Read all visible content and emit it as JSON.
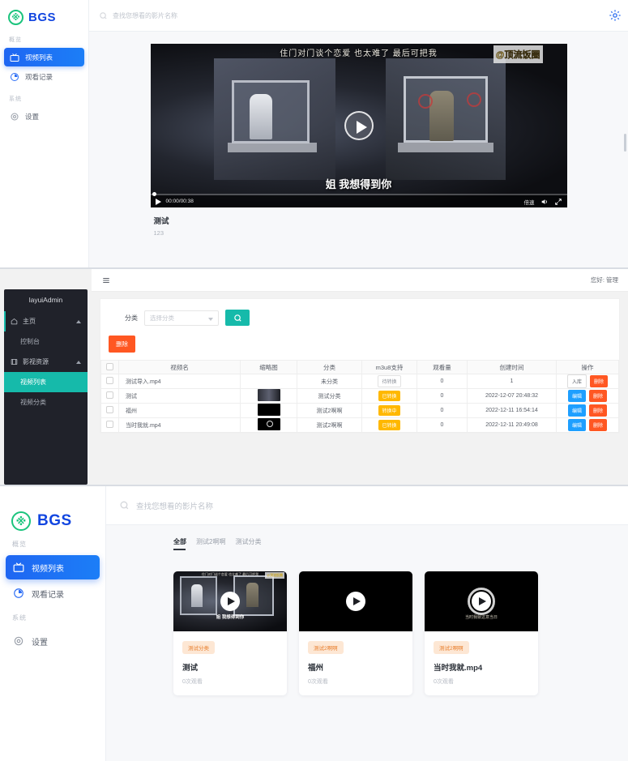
{
  "panel_player": {
    "brand": {
      "logo_char": "※",
      "name": "BGS"
    },
    "nav": {
      "group1_label": "概览",
      "group2_label": "系统",
      "items": [
        {
          "label": "视频列表",
          "icon": "tv-icon",
          "active": true
        },
        {
          "label": "观看记录",
          "icon": "clock-pie-icon",
          "active": false
        },
        {
          "label": "设置",
          "icon": "gear-icon",
          "active": false
        }
      ]
    },
    "search": {
      "placeholder": "查找您想看的影片名称",
      "value": ""
    },
    "settings_icon": "gear-icon",
    "player": {
      "top_caption": "住门对门谈个恋爱 也太难了 最后可把我",
      "watermark": "@顶流饭圈",
      "subtitle": "姐 我想得到你",
      "time": "00:00/00:38",
      "speed_label": "倍速",
      "volume_icon": "volume-icon",
      "fullscreen_icon": "fullscreen-icon",
      "play_icon": "play-icon"
    },
    "video": {
      "title": "测试",
      "description": "123"
    }
  },
  "panel_admin": {
    "brand": "layuiAdmin",
    "header": {
      "menu_icon": "hamburger-icon",
      "user_greeting": "您好: 管理"
    },
    "nav": [
      {
        "label": "主页",
        "icon": "home-icon",
        "type": "parent",
        "expanded": true
      },
      {
        "label": "控制台",
        "type": "child",
        "active": false
      },
      {
        "label": "影视资源",
        "icon": "film-icon",
        "type": "parent",
        "expanded": true
      },
      {
        "label": "视频列表",
        "type": "child",
        "active": true
      },
      {
        "label": "视频分类",
        "type": "child",
        "active": false
      }
    ],
    "filter": {
      "label": "分类",
      "select_placeholder": "选择分类",
      "search_icon": "search-icon",
      "delete_label": "删除"
    },
    "table": {
      "columns": [
        "",
        "视频名",
        "缩略图",
        "分类",
        "m3u8支持",
        "观看量",
        "创建时间",
        "操作"
      ],
      "rows": [
        {
          "name": "测试导入.mp4",
          "thumb": "none",
          "category": "未分类",
          "m3u8": "待转换",
          "m3u8_style": "grey",
          "views": "0",
          "created": "1",
          "actions": [
            {
              "label": "入库",
              "style": "plain",
              "icon": "edit-icon"
            },
            {
              "label": "删除",
              "style": "red",
              "icon": "trash-icon"
            }
          ]
        },
        {
          "name": "测试",
          "thumb": "scene",
          "category": "测试分类",
          "m3u8": "已转换",
          "m3u8_style": "orange",
          "views": "0",
          "created": "2022-12-07 20:48:32",
          "actions": [
            {
              "label": "编辑",
              "style": "blue",
              "icon": "edit-icon"
            },
            {
              "label": "删除",
              "style": "red",
              "icon": "trash-icon"
            }
          ]
        },
        {
          "name": "福州",
          "thumb": "black",
          "category": "测试2啊啊",
          "m3u8": "转换中",
          "m3u8_style": "orange",
          "views": "0",
          "created": "2022-12-11 16:54:14",
          "actions": [
            {
              "label": "编辑",
              "style": "blue",
              "icon": "edit-icon"
            },
            {
              "label": "删除",
              "style": "red",
              "icon": "trash-icon"
            }
          ]
        },
        {
          "name": "当时我就.mp4",
          "thumb": "ring",
          "category": "测试2啊啊",
          "m3u8": "已转换",
          "m3u8_style": "orange",
          "views": "0",
          "created": "2022-12-11 20:49:08",
          "actions": [
            {
              "label": "编辑",
              "style": "blue",
              "icon": "edit-icon"
            },
            {
              "label": "删除",
              "style": "red",
              "icon": "trash-icon"
            }
          ]
        }
      ]
    }
  },
  "panel_list": {
    "brand": {
      "logo_char": "※",
      "name": "BGS"
    },
    "nav": {
      "group1_label": "概览",
      "group2_label": "系统",
      "items": [
        {
          "label": "视频列表",
          "icon": "tv-icon",
          "active": true
        },
        {
          "label": "观看记录",
          "icon": "clock-pie-icon",
          "active": false
        },
        {
          "label": "设置",
          "icon": "gear-icon",
          "active": false
        }
      ]
    },
    "search": {
      "placeholder": "查找您想看的影片名称",
      "value": ""
    },
    "tabs": [
      {
        "label": "全部",
        "active": true
      },
      {
        "label": "测试2啊啊",
        "active": false
      },
      {
        "label": "测试分类",
        "active": false
      }
    ],
    "cards": [
      {
        "tag": "测试分类",
        "title": "测试",
        "views": "0次观看",
        "thumb": "scene",
        "caption": "姐 我想得到你"
      },
      {
        "tag": "测试2啊啊",
        "title": "福州",
        "views": "0次观看",
        "thumb": "black",
        "caption": ""
      },
      {
        "tag": "测试2啊啊",
        "title": "当时我就.mp4",
        "views": "0次观看",
        "thumb": "ring",
        "caption": "当时我就这意当日"
      }
    ]
  },
  "colors": {
    "brand_blue": "#1246e0",
    "nav_active": "#1f66f2",
    "logo_green": "#1bc47d",
    "admin_dark": "#20222a",
    "admin_teal": "#16baaa",
    "danger": "#ff5722",
    "info_blue": "#1e9fff",
    "warn_orange": "#ffb800",
    "tag_orange": "#e87e2c"
  }
}
